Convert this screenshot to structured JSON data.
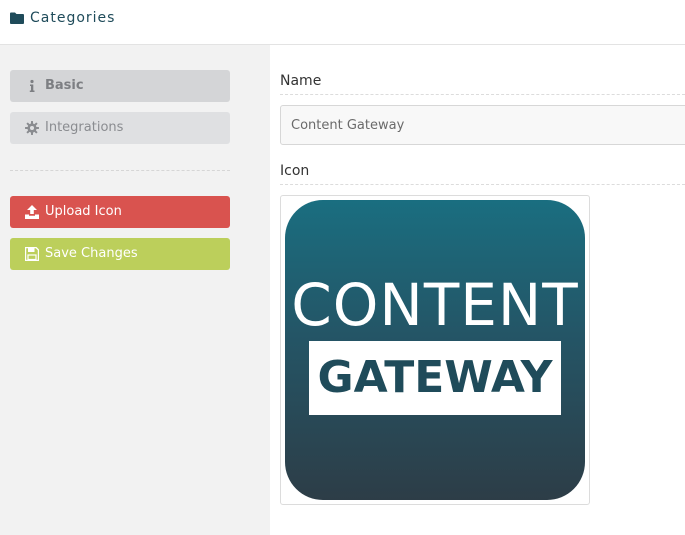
{
  "header": {
    "title": "Categories",
    "icon": "folder-icon"
  },
  "sidebar": {
    "tabs": [
      {
        "label": "Basic",
        "icon": "info-icon"
      },
      {
        "label": "Integrations",
        "icon": "gear-icon"
      }
    ],
    "actions": [
      {
        "label": "Upload Icon",
        "icon": "upload-icon",
        "color": "#d9534f"
      },
      {
        "label": "Save Changes",
        "icon": "floppy-disk-icon",
        "color": "#bccf5b"
      }
    ]
  },
  "form": {
    "name_label": "Name",
    "name_value": "Content Gateway",
    "icon_label": "Icon"
  },
  "icon_image": {
    "line1": "CONTENT",
    "line2": "GATEWAY"
  },
  "colors": {
    "accent": "#1f4b5a",
    "danger": "#d9534f",
    "success": "#bccf5b"
  }
}
